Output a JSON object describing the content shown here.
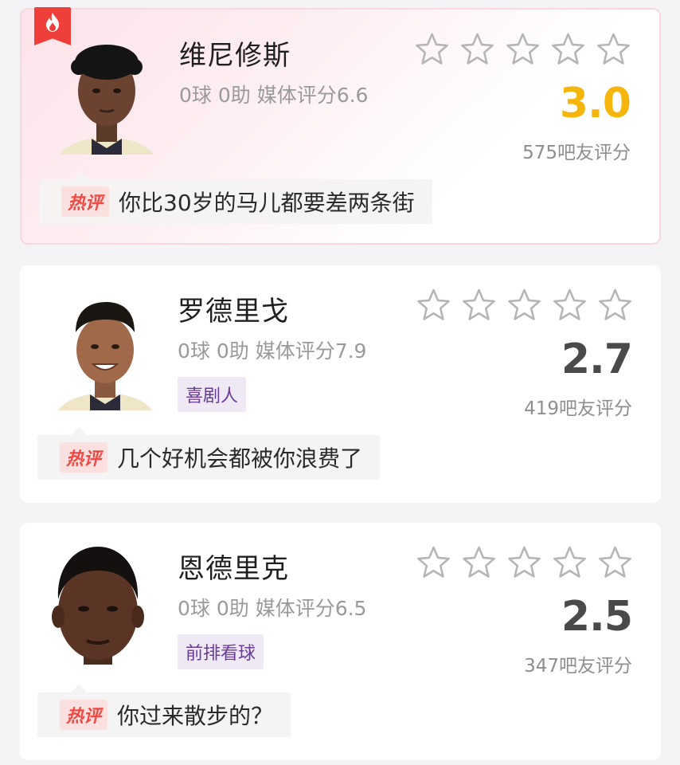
{
  "cards": [
    {
      "name": "维尼修斯",
      "stats": "0球 0助  媒体评分6.6",
      "tag": "",
      "score": "3.0",
      "ratings_count": "575吧友评分",
      "user_rating_stars": 0,
      "comment_label": "热评",
      "comment": "你比30岁的马儿都要差两条街",
      "hot": true
    },
    {
      "name": "罗德里戈",
      "stats": "0球 0助  媒体评分7.9",
      "tag": "喜剧人",
      "score": "2.7",
      "ratings_count": "419吧友评分",
      "user_rating_stars": 0,
      "comment_label": "热评",
      "comment": "几个好机会都被你浪费了",
      "hot": false
    },
    {
      "name": "恩德里克",
      "stats": "0球 0助  媒体评分6.5",
      "tag": "前排看球",
      "score": "2.5",
      "ratings_count": "347吧友评分",
      "user_rating_stars": 0,
      "comment_label": "热评",
      "comment": "你过来散步的？",
      "hot": false
    }
  ],
  "colors": {
    "hot_badge": "#ef3f3a",
    "hot_score": "#f5b50a",
    "score": "#4a4a4a",
    "tag_bg": "#efe9f6",
    "tag_text": "#6a3a9a",
    "hot_label": "#ee4a44"
  },
  "icons": {
    "hot_badge": "flame-icon",
    "star": "star-outline-icon"
  }
}
